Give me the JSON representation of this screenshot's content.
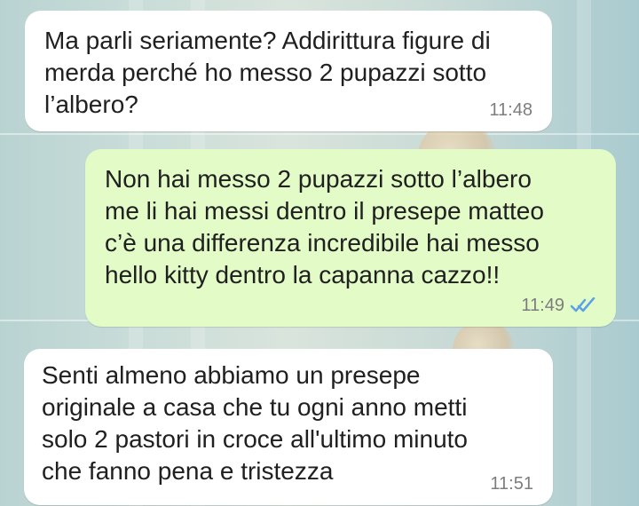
{
  "chat": {
    "messages": [
      {
        "direction": "incoming",
        "text": "Ma parli seriamente? Addirittura figure di\nmerda perché ho messo 2 pupazzi sotto\nl’albero?",
        "time": "11:48"
      },
      {
        "direction": "outgoing",
        "text": "Non hai messo 2 pupazzi sotto l’albero\nme li hai messi dentro il presepe matteo\nc’è una differenza incredibile hai messo\nhello kitty dentro la capanna cazzo!!",
        "time": "11:49",
        "status_icon": "double-check-icon",
        "status_color": "#5aa2e8"
      },
      {
        "direction": "incoming",
        "text": "Senti almeno abbiamo un presepe\noriginale a casa che tu ogni anno metti\nsolo 2 pastori in croce all'ultimo minuto\nche fanno pena e tristezza",
        "time": "11:51"
      }
    ],
    "colors": {
      "incoming_bubble": "#ffffff",
      "outgoing_bubble": "#e2fbc7",
      "timestamp": "#7d7d7d"
    }
  }
}
